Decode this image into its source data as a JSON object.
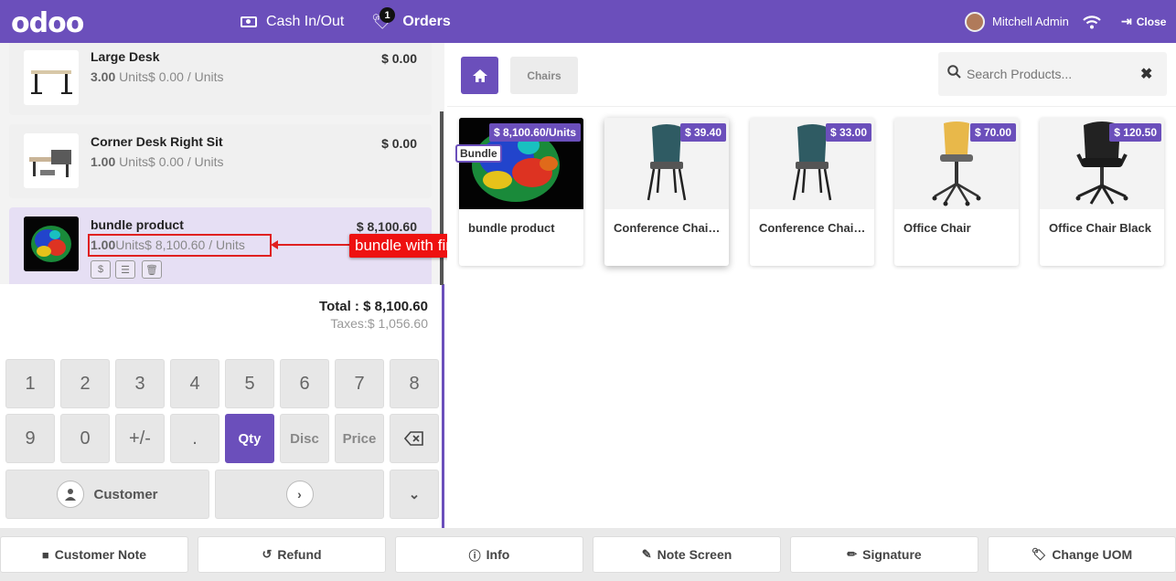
{
  "topbar": {
    "logo": "odoo",
    "cash_label": "Cash In/Out",
    "orders_label": "Orders",
    "orders_count": "1",
    "user_name": "Mitchell Admin",
    "close_label": "Close"
  },
  "order": {
    "lines": [
      {
        "name": "Large Desk",
        "qty": "3.00",
        "unit_text": "Units$ 0.00 / Units",
        "price": "$ 0.00"
      },
      {
        "name": "Corner Desk Right Sit",
        "qty": "1.00",
        "unit_text": "Units$ 0.00 / Units",
        "price": "$ 0.00"
      },
      {
        "name": "bundle product",
        "qty": "1.00",
        "unit_text": "Units$ 8,100.60 / Units",
        "price": "$ 8,100.60"
      }
    ],
    "line_buttons": [
      "$",
      "☰",
      "🗑"
    ],
    "annotation": "bundle with final price",
    "total": "Total : $ 8,100.60",
    "taxes": "Taxes:$ 1,056.60"
  },
  "numpad": {
    "row1": [
      "1",
      "2",
      "3",
      "4",
      "5",
      "6",
      "7",
      "8"
    ],
    "row2": [
      "9",
      "0",
      "+/-",
      ".",
      "Qty",
      "Disc",
      "Price"
    ],
    "customer_label": "Customer"
  },
  "products": {
    "category": "Chairs",
    "search_placeholder": "Search Products...",
    "items": [
      {
        "name": "bundle product",
        "price": "$ 8,100.60/Units",
        "tag": "Bundle"
      },
      {
        "name": "Conference Chair (...",
        "price": "$ 39.40"
      },
      {
        "name": "Conference Chair (...",
        "price": "$ 33.00"
      },
      {
        "name": "Office Chair",
        "price": "$ 70.00"
      },
      {
        "name": "Office Chair Black",
        "price": "$ 120.50"
      }
    ]
  },
  "actions": {
    "customer_note": "Customer Note",
    "refund": "Refund",
    "info": "Info",
    "note_screen": "Note Screen",
    "signature": "Signature",
    "change_uom": "Change UOM"
  },
  "colors": {
    "accent": "#6b4fbb",
    "annotation": "#ee1111"
  }
}
